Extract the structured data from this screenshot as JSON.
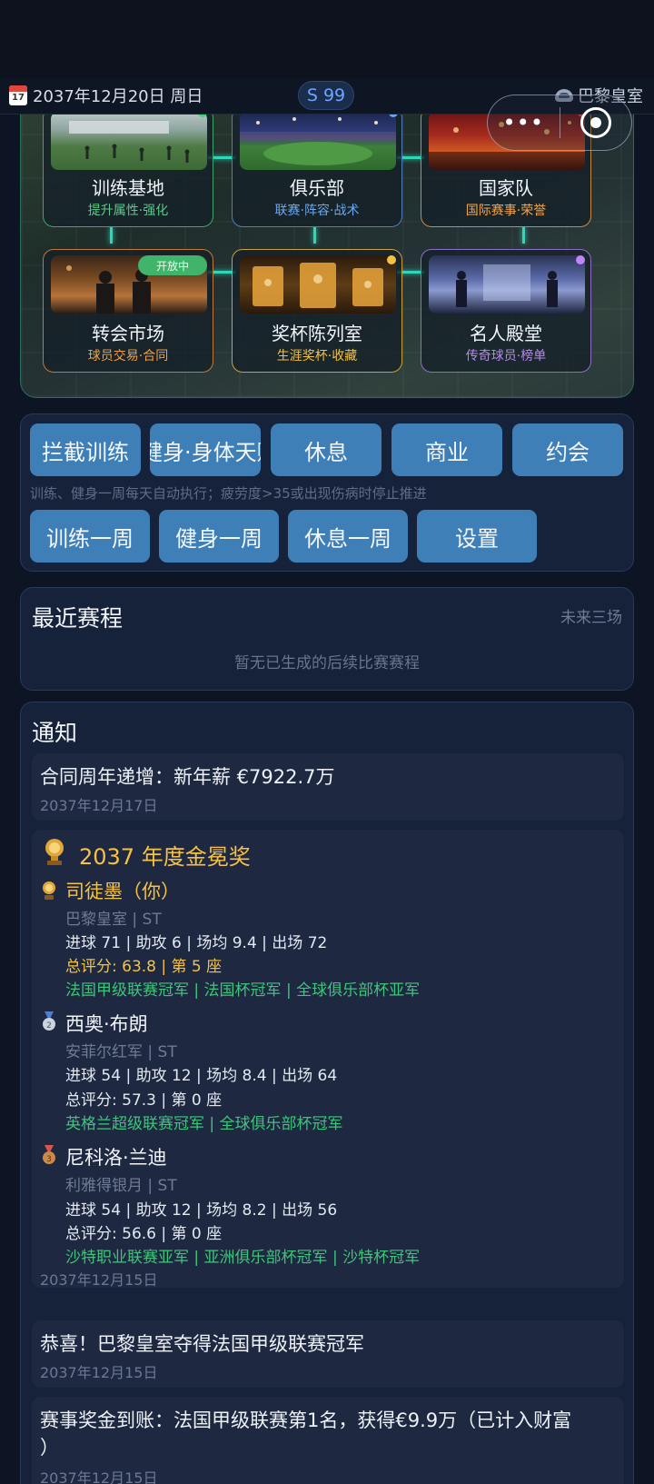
{
  "statusbar": {
    "date": "2037年12月20日 周日",
    "calendar_day": "17",
    "season": "S 99",
    "club": "巴黎皇室"
  },
  "capsule": {
    "more": "•••"
  },
  "facilities": [
    {
      "title": "训练基地",
      "sub": "提升属性·强化",
      "sub_color": "#5cc98a",
      "border": "#3fa56d",
      "dot": "#3fd67a"
    },
    {
      "title": "俱乐部",
      "sub": "联赛·阵容·战术",
      "sub_color": "#6aa7ef",
      "border": "#4f7fb8",
      "dot": "#6aa7ef"
    },
    {
      "title": "国家队",
      "sub": "国际赛事·荣誉",
      "sub_color": "#f1a548",
      "border": "#c98b3a",
      "dot": "#e74c3c"
    },
    {
      "title": "转会市场",
      "sub": "球员交易·合同",
      "sub_color": "#f0a048",
      "border": "#c1793a",
      "badge": "开放中"
    },
    {
      "title": "奖杯陈列室",
      "sub": "生涯奖杯·收藏",
      "sub_color": "#f2c240",
      "border": "#c9a13b",
      "dot": "#f2c240"
    },
    {
      "title": "名人殿堂",
      "sub": "传奇球员·榜单",
      "sub_color": "#b58ae8",
      "border": "#8f6cc7",
      "dot": "#c084fc"
    }
  ],
  "actions": {
    "row1": [
      "拦截训练",
      "健身·身体天赋",
      "休息",
      "商业",
      "约会"
    ],
    "hint": "训练、健身一周每天自动执行；疲劳度>35或出现伤病时停止推进",
    "row2": [
      "训练一周",
      "健身一周",
      "休息一周",
      "设置"
    ]
  },
  "schedule": {
    "title": "最近赛程",
    "right": "未来三场",
    "empty": "暂无已生成的后续比赛赛程"
  },
  "notices": {
    "title": "通知",
    "contract": {
      "title": "合同周年递增：新年薪 €7922.7万",
      "date": "2037年12月17日"
    },
    "award": {
      "title": "2037 年度金冕奖",
      "date": "2037年12月15日",
      "players": [
        {
          "name": "司徒墨（你）",
          "club": "巴黎皇室 | ST",
          "stats": "进球 71 | 助攻 6 | 场均 9.4 | 出场 72",
          "score": "总评分: 63.8 | 第 5 座",
          "honors": "法国甲级联赛冠军 | 法国杯冠军 | 全球俱乐部杯亚军"
        },
        {
          "name": "西奥·布朗",
          "club": "安菲尔红军 | ST",
          "stats": "进球 54 | 助攻 12 | 场均 8.4 | 出场 64",
          "score": "总评分: 57.3 | 第 0 座",
          "honors": "英格兰超级联赛冠军 | 全球俱乐部杯冠军"
        },
        {
          "name": "尼科洛·兰迪",
          "club": "利雅得银月 | ST",
          "stats": "进球 54 | 助攻 12 | 场均 8.2 | 出场 56",
          "score": "总评分: 56.6 | 第 0 座",
          "honors": "沙特职业联赛亚军 | 亚洲俱乐部杯冠军 | 沙特杯冠军"
        }
      ]
    },
    "league": {
      "title": "恭喜！巴黎皇室夺得法国甲级联赛冠军",
      "date": "2037年12月15日"
    },
    "prize": {
      "title": "赛事奖金到账：法国甲级联赛第1名，获得€9.9万（已计入财富",
      "title2": "）",
      "date": "2037年12月15日"
    }
  },
  "colors": {
    "accent": "#3f7fb8",
    "gold": "#f5c242",
    "green": "#3fc57a",
    "panel": "#16213a"
  }
}
